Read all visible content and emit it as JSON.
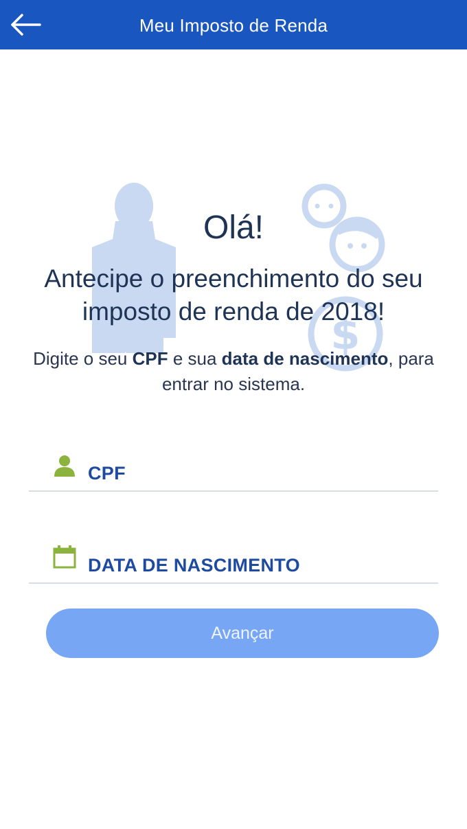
{
  "header": {
    "title": "Meu Imposto de Renda",
    "back_icon": "arrow-left-icon"
  },
  "hero": {
    "greeting": "Olá!",
    "headline": "Antecipe o preenchimento do seu imposto de renda de 2018!",
    "instructions": {
      "part1": "Digite o seu ",
      "bold1": "CPF",
      "part2": " e sua ",
      "bold2": "data de nascimento",
      "part3": ", para entrar no sistema."
    },
    "illustration_icons": [
      "man-silhouette-icon",
      "children-faces-icon",
      "money-coin-icon"
    ]
  },
  "form": {
    "cpf": {
      "label": "CPF",
      "icon": "user-icon",
      "value": ""
    },
    "birth_date": {
      "label": "DATA DE NASCIMENTO",
      "icon": "calendar-icon",
      "value": ""
    }
  },
  "actions": {
    "advance_label": "Avançar"
  },
  "colors": {
    "header_bg": "#1a56bf",
    "title_text": "#1f3354",
    "field_label": "#1e4aa0",
    "field_icon": "#8cb33e",
    "button_bg": "#77a6f5",
    "illustration": "#c9d9f1"
  }
}
